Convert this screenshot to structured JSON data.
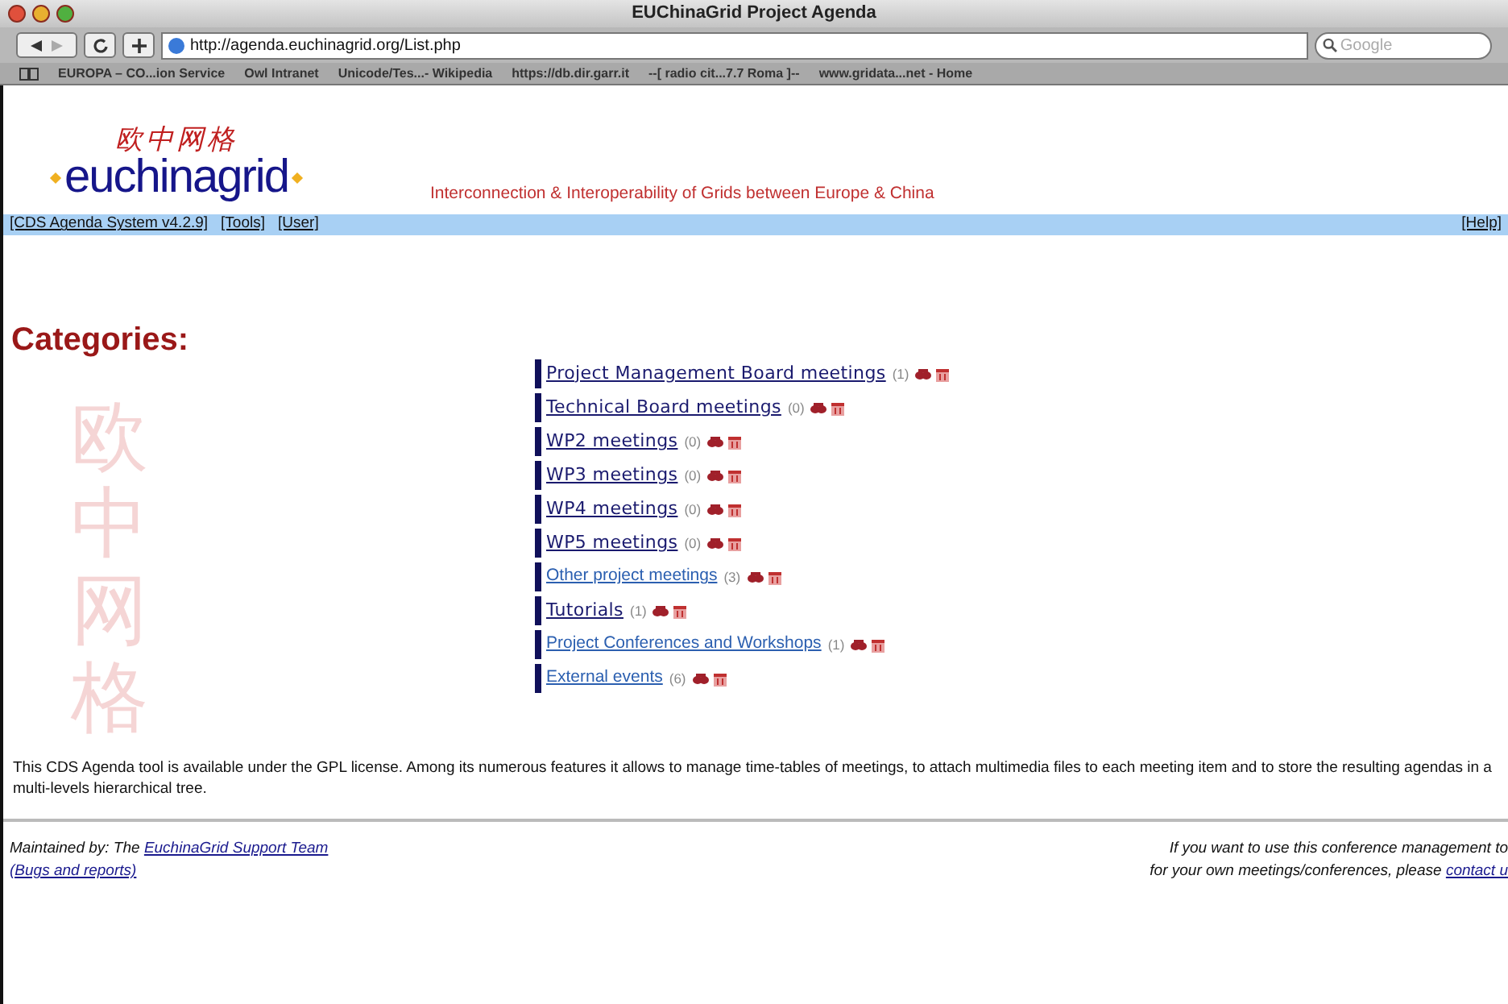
{
  "window": {
    "title": "EUChinaGrid Project Agenda"
  },
  "toolbar": {
    "url": "http://agenda.euchinagrid.org/List.php",
    "search_placeholder": "Google"
  },
  "bookmarks": [
    "EUROPA – CO...ion Service",
    "Owl Intranet",
    "Unicode/Tes...- Wikipedia",
    "https://db.dir.garr.it",
    "--[ radio cit...7.7 Roma ]--",
    "www.gridata...net - Home"
  ],
  "logo": {
    "chinese": "欧中网格",
    "latin": "euchinagrid"
  },
  "tagline": "Interconnection & Interoperability of Grids between Europe & China",
  "navbar": {
    "left": [
      "[CDS Agenda System v4.2.9]",
      "[Tools]",
      "[User]"
    ],
    "right": "[Help]"
  },
  "watermark": [
    "欧",
    "中",
    "网",
    "格"
  ],
  "heading": "Categories:",
  "categories": [
    {
      "label": "Project Management Board meetings",
      "count": "(1)",
      "kind": "group"
    },
    {
      "label": "Technical Board meetings",
      "count": "(0)",
      "kind": "group"
    },
    {
      "label": "WP2 meetings",
      "count": "(0)",
      "kind": "group"
    },
    {
      "label": "WP3 meetings",
      "count": "(0)",
      "kind": "group"
    },
    {
      "label": "WP4 meetings",
      "count": "(0)",
      "kind": "group"
    },
    {
      "label": "WP5 meetings",
      "count": "(0)",
      "kind": "group"
    },
    {
      "label": "Other project meetings",
      "count": "(3)",
      "kind": "list"
    },
    {
      "label": "Tutorials",
      "count": "(1)",
      "kind": "group"
    },
    {
      "label": "Project Conferences and Workshops",
      "count": "(1)",
      "kind": "list"
    },
    {
      "label": "External events",
      "count": "(6)",
      "kind": "list"
    }
  ],
  "description": "This CDS Agenda tool is available under the GPL license. Among its numerous features it allows to manage time-tables of meetings, to attach multimedia files to each meeting item and to store the resulting agendas in a multi-levels hierarchical tree.",
  "footer": {
    "maintained_prefix": "Maintained by: The",
    "maintained_link": "EuchinaGrid Support Team",
    "bugs_link": "(Bugs and reports)",
    "right_line1": "If you want to use this conference management to",
    "right_line2_prefix": "for your own meetings/conferences, please",
    "right_link": "contact u"
  }
}
